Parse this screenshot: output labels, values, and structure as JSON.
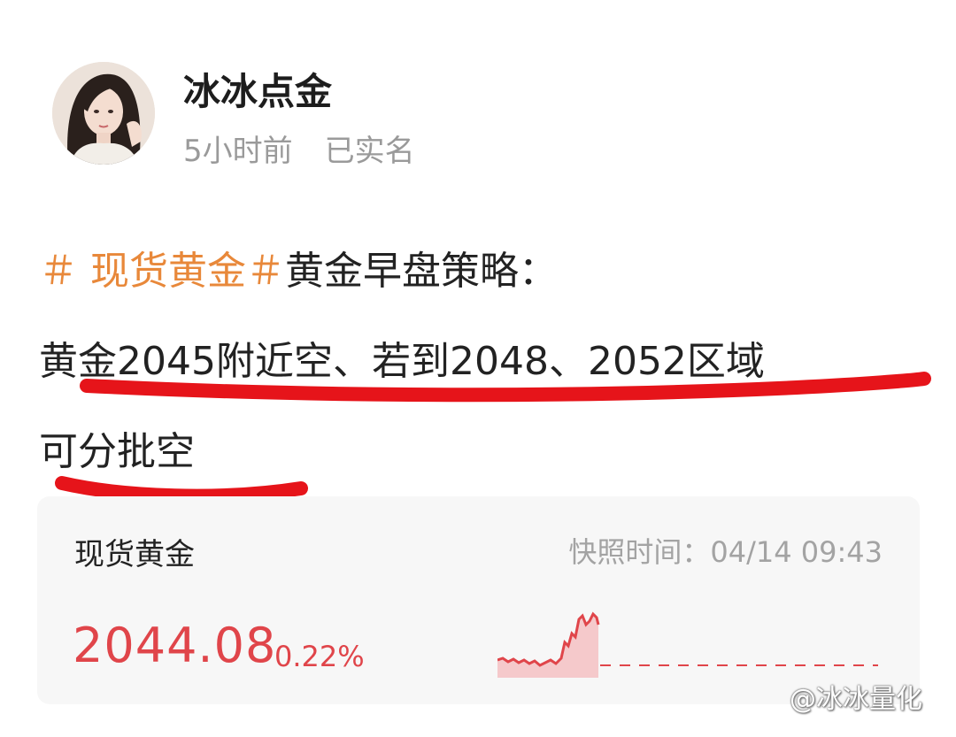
{
  "author": {
    "name": "冰冰点金",
    "time": "5小时前",
    "verified": "已实名"
  },
  "post": {
    "hashtag": "＃ 现货黄金＃",
    "title": "黄金早盘策略：",
    "line2": "黄金2045附近空、若到2048、2052区域",
    "line3": "可分批空"
  },
  "card": {
    "name": "现货黄金",
    "snapshot_label": "快照时间：",
    "snapshot_time": "04/14 09:43",
    "price": "2044.08",
    "change": "0.22%",
    "price_color": "#e0454a"
  },
  "watermark": "@冰冰量化",
  "colors": {
    "hashtag": "#e8883a",
    "underline": "#e6141a"
  }
}
